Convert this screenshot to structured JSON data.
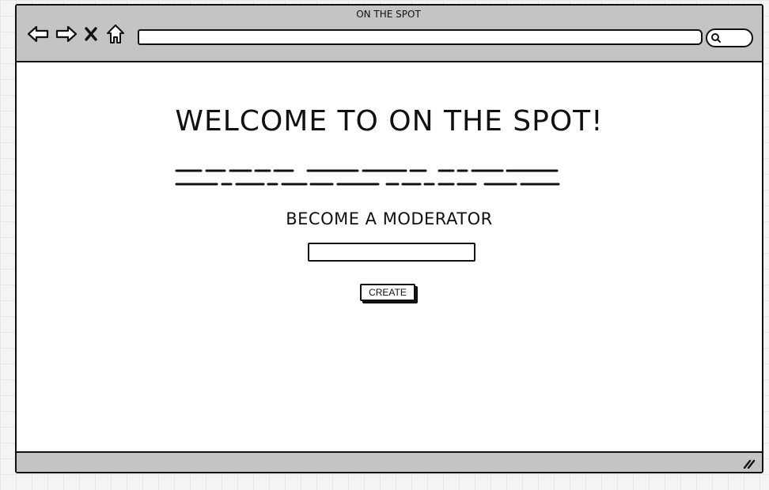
{
  "window": {
    "title": "ON THE SPOT",
    "address": "",
    "search": ""
  },
  "toolbar": {
    "back_icon": "arrow-left-icon",
    "forward_icon": "arrow-right-icon",
    "stop_icon": "close-icon",
    "home_icon": "home-icon",
    "search_icon": "search-icon"
  },
  "page": {
    "headline": "WELCOME TO ON THE SPOT!",
    "subheading": "BECOME A MODERATOR",
    "input_value": "",
    "create_label": "CREATE"
  },
  "colors": {
    "chrome": "#c4c4c4",
    "ink": "#111111",
    "canvas": "#ffffff"
  }
}
